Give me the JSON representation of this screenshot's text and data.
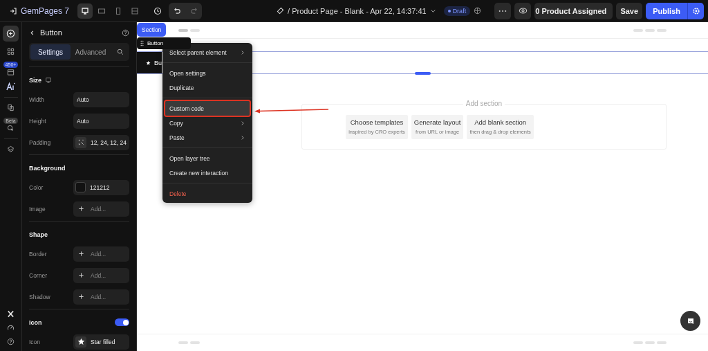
{
  "topbar": {
    "brand": "GemPages 7",
    "devices": [
      {
        "kind": "desktop",
        "selected": true
      },
      {
        "kind": "laptop",
        "selected": false
      },
      {
        "kind": "mobile",
        "selected": false
      },
      {
        "kind": "fit",
        "selected": false
      }
    ],
    "page_title": "/ Product Page - Blank - Apr 22, 14:37:41",
    "status": "Draft",
    "product_assigned": "0 Product Assigned",
    "save": "Save",
    "publish": "Publish"
  },
  "rail": {
    "badges": [
      "450+",
      "Beta"
    ]
  },
  "panel": {
    "title": "Button",
    "tabs": [
      {
        "label": "Settings",
        "selected": true
      },
      {
        "label": "Advanced",
        "selected": false
      }
    ],
    "sections": [
      {
        "title": "Size",
        "rows": [
          {
            "kind": "value",
            "label": "Width",
            "value": "Auto"
          },
          {
            "kind": "value",
            "label": "Height",
            "value": "Auto"
          },
          {
            "kind": "padding",
            "label": "Padding",
            "value": "12, 24, 12, 24"
          }
        ]
      },
      {
        "title": "Background",
        "rows": [
          {
            "kind": "color",
            "label": "Color",
            "value": "121212",
            "color": "#121212"
          },
          {
            "kind": "add",
            "label": "Image",
            "placeholder": "Add..."
          }
        ]
      },
      {
        "title": "Shape",
        "rows": [
          {
            "kind": "add",
            "label": "Border",
            "placeholder": "Add..."
          },
          {
            "kind": "add",
            "label": "Corner",
            "placeholder": "Add..."
          },
          {
            "kind": "add",
            "label": "Shadow",
            "placeholder": "Add..."
          }
        ]
      },
      {
        "title": "Icon",
        "toggle": true,
        "rows": [
          {
            "kind": "icon",
            "label": "Icon",
            "value": "Star filled"
          }
        ]
      }
    ]
  },
  "canvas": {
    "section_tag": "Section",
    "element_tag": "Button",
    "button_preview": "Bu",
    "add_section": {
      "label": "Add section",
      "options": [
        {
          "title": "Choose templates",
          "subtitle": "inspired by CRO experts"
        },
        {
          "title": "Generate layout",
          "subtitle": "from URL or image"
        },
        {
          "title": "Add blank section",
          "subtitle": "then drag & drop elements"
        }
      ]
    }
  },
  "context_menu": [
    [
      {
        "label": "Select parent element",
        "submenu": true,
        "highlighted": false,
        "kind": "normal"
      }
    ],
    [
      {
        "label": "Open settings",
        "submenu": false,
        "highlighted": false,
        "kind": "normal"
      },
      {
        "label": "Duplicate",
        "submenu": false,
        "highlighted": false,
        "kind": "normal"
      }
    ],
    [
      {
        "label": "Custom code",
        "submenu": false,
        "highlighted": true,
        "kind": "normal"
      },
      {
        "label": "Copy",
        "submenu": true,
        "highlighted": false,
        "kind": "normal"
      },
      {
        "label": "Paste",
        "submenu": true,
        "highlighted": false,
        "kind": "normal"
      }
    ],
    [
      {
        "label": "Open layer tree",
        "submenu": false,
        "highlighted": false,
        "kind": "normal"
      },
      {
        "label": "Create new interaction",
        "submenu": false,
        "highlighted": false,
        "kind": "normal"
      }
    ],
    [
      {
        "label": "Delete",
        "submenu": false,
        "highlighted": false,
        "kind": "danger"
      }
    ]
  ]
}
